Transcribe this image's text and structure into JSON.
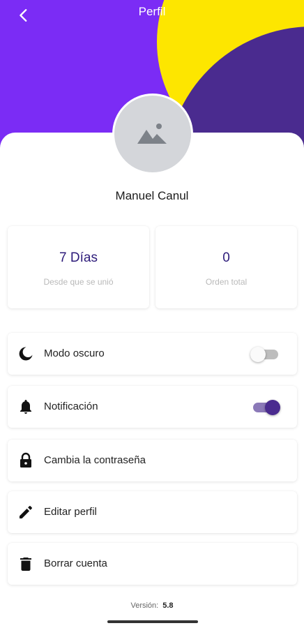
{
  "header": {
    "title": "Perfil"
  },
  "profile": {
    "name": "Manuel Canul"
  },
  "stats": [
    {
      "value": "7 Días",
      "label": "Desde que se unió"
    },
    {
      "value": "0",
      "label": "Orden total"
    }
  ],
  "settings": [
    {
      "label": "Modo oscuro",
      "icon": "moon-icon",
      "toggle": false
    },
    {
      "label": "Notificación",
      "icon": "bell-icon",
      "toggle": true
    },
    {
      "label": "Cambia la contraseña",
      "icon": "lock-icon"
    },
    {
      "label": "Editar perfil",
      "icon": "pencil-icon"
    },
    {
      "label": "Borrar cuenta",
      "icon": "trash-icon"
    }
  ],
  "footer": {
    "version_label": "Versión:",
    "version_value": "5.8"
  },
  "colors": {
    "purple": "#7b2cf5",
    "yellow": "#fde600",
    "navy": "#4a2b8f",
    "accent": "#2d1b7a"
  }
}
